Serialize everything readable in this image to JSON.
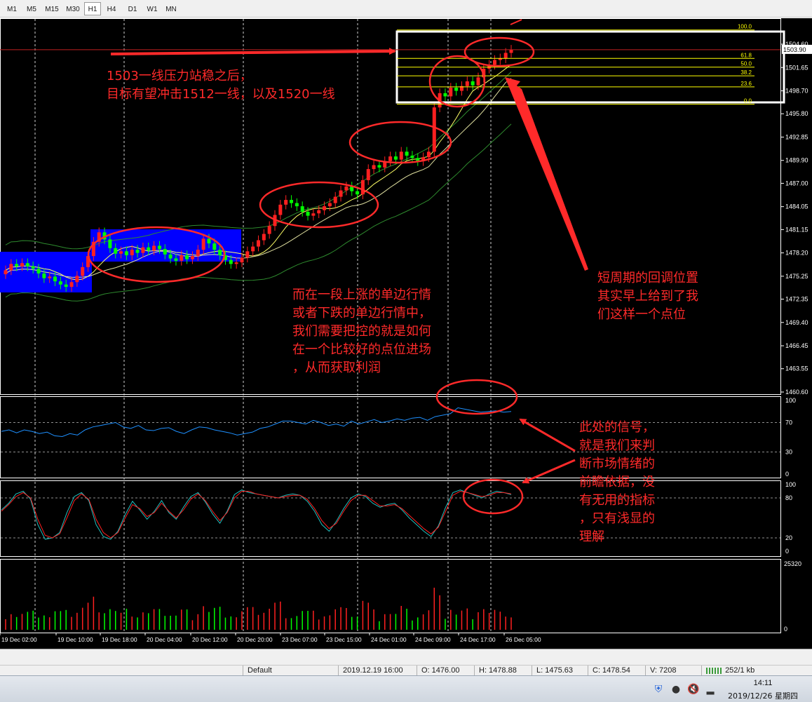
{
  "toolbar": {
    "timeframes": [
      {
        "label": "M1"
      },
      {
        "label": "M5"
      },
      {
        "label": "M15"
      },
      {
        "label": "M30"
      },
      {
        "label": "H1",
        "active": true
      },
      {
        "label": "H4"
      },
      {
        "label": "D1"
      },
      {
        "label": "W1"
      },
      {
        "label": "MN"
      }
    ]
  },
  "chart": {
    "price_axis_labels": [
      "1504.60",
      "1501.65",
      "1498.70",
      "1495.80",
      "1492.85",
      "1489.90",
      "1487.00",
      "1484.05",
      "1481.15",
      "1478.20",
      "1475.25",
      "1472.35",
      "1469.40",
      "1466.45",
      "1463.55",
      "1460.60"
    ],
    "current_price": "1503.90",
    "fib_levels": [
      {
        "label": "100.0",
        "price": 1506.4
      },
      {
        "label": "61.8",
        "price": 1502.8
      },
      {
        "label": "50.0",
        "price": 1501.7
      },
      {
        "label": "38.2",
        "price": 1500.6
      },
      {
        "label": "23.6",
        "price": 1499.2
      },
      {
        "label": "0.0",
        "price": 1497.0
      }
    ],
    "rsi_axis_labels": [
      "100",
      "70",
      "30",
      "0"
    ],
    "stoch_axis_labels": [
      "100",
      "80",
      "20",
      "0"
    ],
    "volume_axis_labels": [
      "25320",
      "0"
    ],
    "time_labels": [
      "19 Dec 02:00",
      "19 Dec 10:00",
      "19 Dec 18:00",
      "20 Dec 04:00",
      "20 Dec 12:00",
      "20 Dec 20:00",
      "23 Dec 07:00",
      "23 Dec 15:00",
      "24 Dec 01:00",
      "24 Dec 09:00",
      "24 Dec 17:00",
      "26 Dec 05:00"
    ],
    "colors": {
      "bull": "#ff2020",
      "bear": "#00ff00",
      "rsi": "#1e90ff",
      "stoch_main": "#20c0c0",
      "stoch_signal": "#ff2020",
      "fib": "#ffff00",
      "annotation": "#ff2a2a"
    },
    "closes": [
      1476.0,
      1476.8,
      1476.5,
      1476.9,
      1476.5,
      1476.2,
      1475.6,
      1475.0,
      1475.2,
      1474.6,
      1474.2,
      1473.9,
      1474.5,
      1475.3,
      1476.4,
      1477.8,
      1479.6,
      1480.8,
      1479.9,
      1478.8,
      1478.1,
      1478.4,
      1477.9,
      1478.6,
      1478.2,
      1478.9,
      1478.5,
      1479.1,
      1478.7,
      1478.0,
      1477.5,
      1477.2,
      1477.9,
      1477.4,
      1477.8,
      1478.6,
      1480.0,
      1479.4,
      1478.6,
      1477.9,
      1477.3,
      1476.8,
      1477.0,
      1477.6,
      1478.4,
      1479.0,
      1479.8,
      1480.6,
      1481.6,
      1483.0,
      1484.3,
      1484.9,
      1484.5,
      1484.1,
      1483.4,
      1482.9,
      1483.2,
      1483.6,
      1484.1,
      1484.5,
      1485.3,
      1486.1,
      1486.6,
      1486.0,
      1485.6,
      1487.4,
      1488.8,
      1489.3,
      1489.0,
      1489.8,
      1490.4,
      1490.0,
      1491.0,
      1490.5,
      1490.2,
      1489.8,
      1490.3,
      1491.0,
      1496.6,
      1498.4,
      1498.0,
      1499.1,
      1498.7,
      1499.3,
      1499.9,
      1499.4,
      1500.4,
      1501.5,
      1502.0,
      1502.6,
      1502.8,
      1503.5,
      1503.9
    ],
    "rsi": [
      58,
      60,
      56,
      60,
      58,
      55,
      57,
      52,
      51,
      55,
      53,
      60,
      64,
      66,
      68,
      70,
      64,
      62,
      66,
      60,
      59,
      62,
      63,
      58,
      55,
      60,
      64,
      63,
      60,
      58,
      56,
      53,
      55,
      57,
      62,
      64,
      68,
      72,
      72,
      70,
      68,
      73,
      70,
      66,
      68,
      65,
      72,
      68,
      71,
      74,
      70,
      72,
      75,
      73,
      76,
      77,
      73,
      78,
      80,
      82,
      90,
      88,
      86,
      84,
      85,
      86,
      84,
      85
    ],
    "stoch_main": [
      62,
      72,
      86,
      90,
      78,
      40,
      18,
      20,
      28,
      58,
      82,
      88,
      76,
      40,
      22,
      18,
      30,
      55,
      75,
      62,
      48,
      60,
      76,
      58,
      48,
      66,
      82,
      88,
      74,
      56,
      42,
      60,
      85,
      92,
      88,
      86,
      84,
      82,
      80,
      84,
      86,
      84,
      75,
      60,
      40,
      30,
      45,
      64,
      80,
      86,
      82,
      72,
      66,
      70,
      72,
      62,
      50,
      40,
      30,
      22,
      38,
      66,
      88,
      92,
      88,
      84,
      80,
      86,
      90,
      88,
      85
    ],
    "stoch_signal": [
      60,
      70,
      82,
      88,
      80,
      48,
      24,
      20,
      26,
      50,
      76,
      86,
      78,
      48,
      28,
      20,
      28,
      50,
      70,
      64,
      52,
      58,
      72,
      60,
      50,
      62,
      78,
      86,
      76,
      60,
      46,
      58,
      80,
      90,
      90,
      86,
      84,
      82,
      80,
      82,
      84,
      84,
      78,
      64,
      46,
      34,
      42,
      60,
      76,
      84,
      84,
      76,
      68,
      68,
      70,
      64,
      54,
      44,
      34,
      26,
      36,
      60,
      84,
      90,
      88,
      85,
      82,
      84,
      88,
      88,
      86
    ],
    "annotations": {
      "note1": "1503一线压力站稳之后，\n目标有望冲击1512一线，以及1520一线",
      "note2": "而在一段上涨的单边行情\n或者下跌的单边行情中，\n我们需要把控的就是如何\n在一个比较好的点位进场\n，从而获取利润",
      "note3": "短周期的回调位置\n其实早上给到了我\n们这样一个点位",
      "note4": "此处的信号，\n就是我们来判\n断市场情绪的\n前瞻依据，没\n有无用的指标\n，只有浅显的\n理解"
    }
  },
  "statusbar": {
    "profile": "Default",
    "time": "2019.12.19 16:00",
    "open": "O: 1476.00",
    "high": "H: 1478.88",
    "low": "L: 1475.63",
    "close": "C: 1478.54",
    "volume": "V: 7208",
    "traffic": "252/1 kb"
  },
  "taskbar": {
    "time": "14:11",
    "date": "2019/12/26 星期四"
  }
}
